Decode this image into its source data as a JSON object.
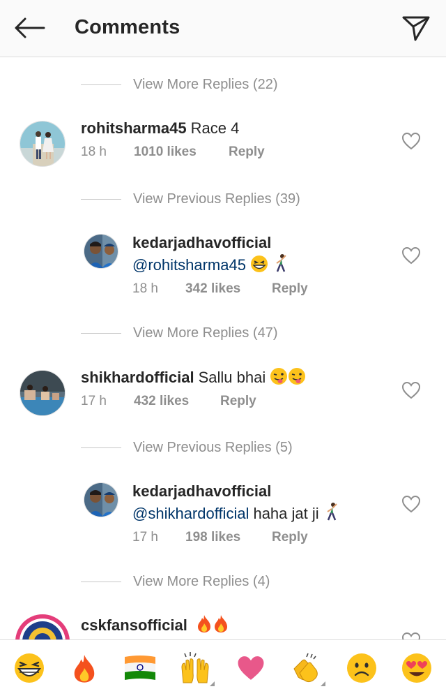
{
  "header": {
    "title": "Comments",
    "back_icon": "arrow-left-icon",
    "send_icon": "direct-send-icon"
  },
  "threads": [
    {
      "type": "toggle",
      "label": "View More Replies (22)"
    },
    {
      "type": "comment",
      "username": "rohitsharma45",
      "text": "Race 4",
      "time": "18 h",
      "likes": "1010 likes",
      "reply": "Reply"
    },
    {
      "type": "toggle",
      "label": "View Previous Replies (39)"
    },
    {
      "type": "reply",
      "username": "kedarjadhavofficial",
      "mention": "@rohitsharma45",
      "text": "",
      "emojis": [
        "grinning-squint-emoji",
        "dancing-man-emoji"
      ],
      "time": "18 h",
      "likes": "342 likes",
      "reply": "Reply"
    },
    {
      "type": "toggle",
      "label": "View More Replies (47)"
    },
    {
      "type": "comment",
      "username": "shikhardofficial",
      "text": "Sallu bhai",
      "emojis": [
        "winking-tongue-emoji",
        "winking-tongue-emoji"
      ],
      "time": "17 h",
      "likes": "432 likes",
      "reply": "Reply"
    },
    {
      "type": "toggle",
      "label": "View Previous Replies (5)"
    },
    {
      "type": "reply",
      "username": "kedarjadhavofficial",
      "mention": "@shikhardofficial",
      "text": "haha jat ji",
      "emojis": [
        "dancing-man-emoji"
      ],
      "time": "17 h",
      "likes": "198 likes",
      "reply": "Reply"
    },
    {
      "type": "toggle",
      "label": "View More Replies (4)"
    },
    {
      "type": "comment",
      "username": "cskfansofficial",
      "text": "",
      "emojis": [
        "fire-emoji",
        "fire-emoji"
      ]
    }
  ],
  "emoji_bar": [
    {
      "name": "grinning-emoji",
      "more": false
    },
    {
      "name": "fire-emoji",
      "more": false
    },
    {
      "name": "india-flag-emoji",
      "more": false
    },
    {
      "name": "raised-hands-emoji",
      "more": true
    },
    {
      "name": "heart-emoji",
      "more": false
    },
    {
      "name": "clapping-hands-emoji",
      "more": true
    },
    {
      "name": "frowning-emoji",
      "more": false
    },
    {
      "name": "heart-eyes-emoji",
      "more": false
    }
  ],
  "colors": {
    "text": "#262626",
    "secondary": "#8e8e8e",
    "mention": "#003569",
    "divider": "#dbdbdb"
  }
}
